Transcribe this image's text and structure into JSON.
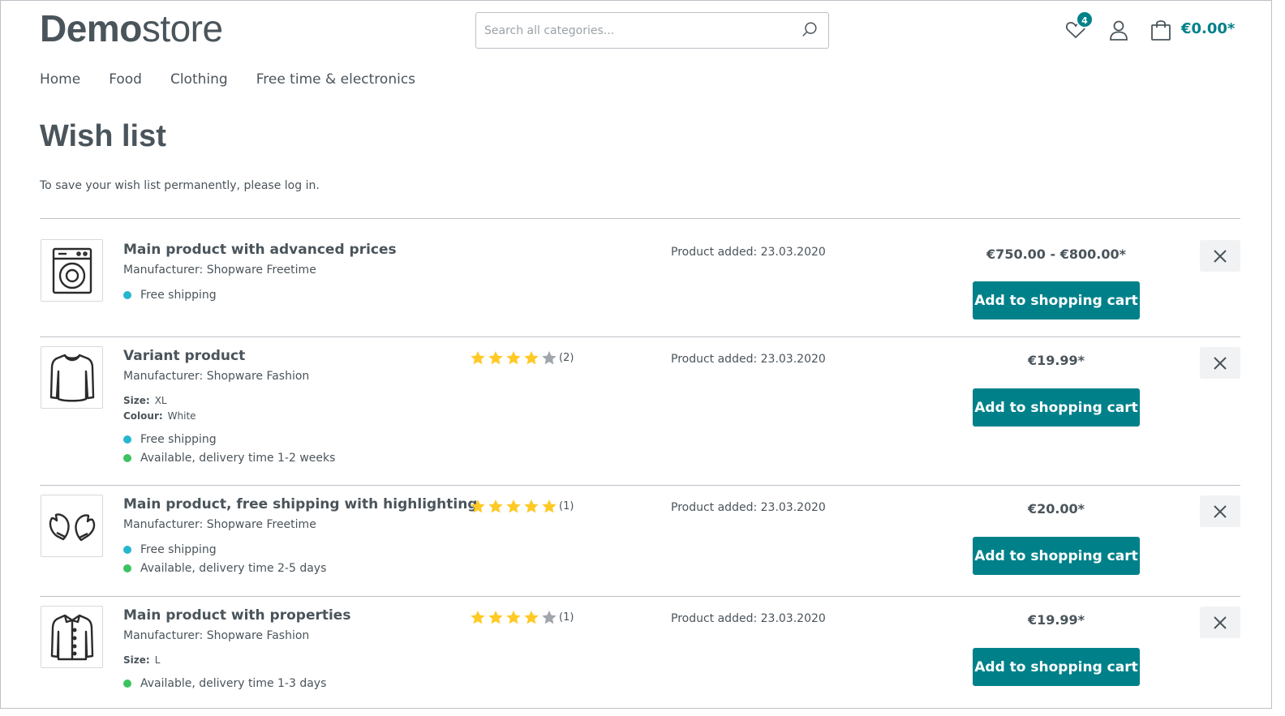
{
  "header": {
    "logo_bold": "Demo",
    "logo_light": "store",
    "search_placeholder": "Search all categories...",
    "wishlist_count": "4",
    "cart_total": "€0.00*"
  },
  "nav": [
    "Home",
    "Food",
    "Clothing",
    "Free time & electronics"
  ],
  "page": {
    "title": "Wish list",
    "info": "To save your wish list permanently, please log in."
  },
  "items": [
    {
      "name": "Main product with advanced prices",
      "manufacturer": "Manufacturer: Shopware Freetime",
      "icon": "washing-machine-icon",
      "rating": null,
      "properties": [],
      "availability": [
        {
          "text": "Free shipping",
          "color": "#26b6cf"
        }
      ],
      "added": "Product added: 23.03.2020",
      "price": "€750.00 - €800.00*",
      "button": "Add to shopping cart"
    },
    {
      "name": "Variant product",
      "manufacturer": "Manufacturer: Shopware Fashion",
      "icon": "sweater-icon",
      "rating": {
        "filled": 4,
        "total": 5,
        "count": "(2)"
      },
      "properties": [
        {
          "label": "Size:",
          "value": "XL"
        },
        {
          "label": "Colour:",
          "value": "White"
        }
      ],
      "availability": [
        {
          "text": "Free shipping",
          "color": "#26b6cf"
        },
        {
          "text": "Available, delivery time 1-2 weeks",
          "color": "#3cc261"
        }
      ],
      "added": "Product added: 23.03.2020",
      "price": "€19.99*",
      "button": "Add to shopping cart"
    },
    {
      "name": "Main product, free shipping with highlighting",
      "manufacturer": "Manufacturer: Shopware Freetime",
      "icon": "mittens-icon",
      "rating": {
        "filled": 5,
        "total": 5,
        "count": "(1)"
      },
      "properties": [],
      "availability": [
        {
          "text": "Free shipping",
          "color": "#26b6cf"
        },
        {
          "text": "Available, delivery time 2-5 days",
          "color": "#3cc261"
        }
      ],
      "added": "Product added: 23.03.2020",
      "price": "€20.00*",
      "button": "Add to shopping cart"
    },
    {
      "name": "Main product with properties",
      "manufacturer": "Manufacturer: Shopware Fashion",
      "icon": "jacket-icon",
      "rating": {
        "filled": 4,
        "total": 5,
        "count": "(1)"
      },
      "properties": [
        {
          "label": "Size:",
          "value": "L"
        }
      ],
      "availability": [
        {
          "text": "Available, delivery time 1-3 days",
          "color": "#3cc261"
        }
      ],
      "added": "Product added: 23.03.2020",
      "price": "€19.99*",
      "button": "Add to shopping cart"
    }
  ],
  "colors": {
    "accent": "#00818a",
    "text": "#4a545b",
    "star": "#ffc926",
    "star_empty": "#a0a6ab"
  }
}
